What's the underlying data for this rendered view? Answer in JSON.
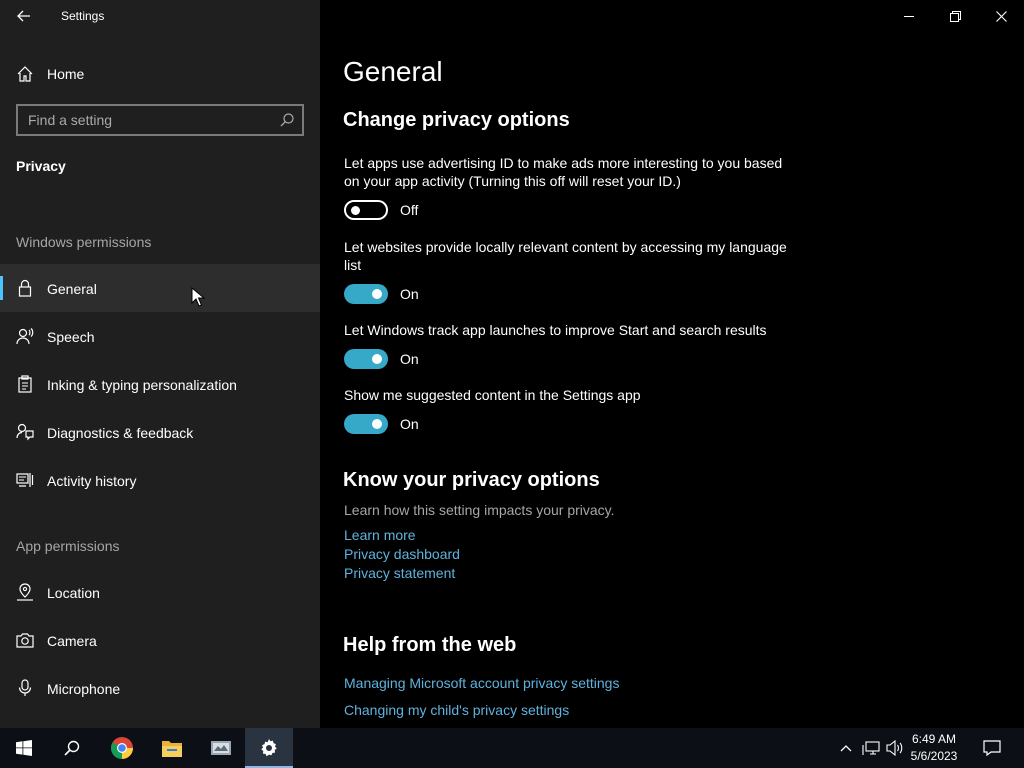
{
  "window": {
    "title": "Settings",
    "back_icon": "back-arrow-icon",
    "controls": [
      "minimize-icon",
      "restore-icon",
      "close-icon"
    ]
  },
  "sidebar": {
    "home_label": "Home",
    "search_placeholder": "Find a setting",
    "category": "Privacy",
    "windows_permissions_label": "Windows permissions",
    "windows_permissions": [
      {
        "label": "General",
        "icon": "lock-icon",
        "selected": true
      },
      {
        "label": "Speech",
        "icon": "speech-icon",
        "selected": false
      },
      {
        "label": "Inking & typing personalization",
        "icon": "clipboard-icon",
        "selected": false
      },
      {
        "label": "Diagnostics & feedback",
        "icon": "feedback-icon",
        "selected": false
      },
      {
        "label": "Activity history",
        "icon": "activity-icon",
        "selected": false
      }
    ],
    "app_permissions_label": "App permissions",
    "app_permissions": [
      {
        "label": "Location",
        "icon": "location-icon"
      },
      {
        "label": "Camera",
        "icon": "camera-icon"
      },
      {
        "label": "Microphone",
        "icon": "microphone-icon"
      }
    ]
  },
  "main": {
    "title": "General",
    "change_heading": "Change privacy options",
    "settings": [
      {
        "description": "Let apps use advertising ID to make ads more interesting to you based on your app activity (Turning this off will reset your ID.)",
        "state": "Off",
        "on": false
      },
      {
        "description": "Let websites provide locally relevant content by accessing my language list",
        "state": "On",
        "on": true
      },
      {
        "description": "Let Windows track app launches to improve Start and search results",
        "state": "On",
        "on": true
      },
      {
        "description": "Show me suggested content in the Settings app",
        "state": "On",
        "on": true
      }
    ],
    "know_heading": "Know your privacy options",
    "know_desc": "Learn how this setting impacts your privacy.",
    "know_links": [
      "Learn more",
      "Privacy dashboard",
      "Privacy statement"
    ],
    "help_heading": "Help from the web",
    "help_links": [
      "Managing Microsoft account privacy settings",
      "Changing my child's privacy settings"
    ]
  },
  "taskbar": {
    "time": "6:49 AM",
    "date": "5/6/2023",
    "apps": [
      "windows-start-icon",
      "search-icon",
      "chrome-icon",
      "file-explorer-icon",
      "app-icon",
      "settings-gear-icon"
    ]
  },
  "colors": {
    "accent": "#4cc2ff",
    "toggle_on": "#35a9c7",
    "link": "#5fb2dd",
    "sidebar_bg": "#1f1f1f",
    "main_bg": "#000000"
  }
}
